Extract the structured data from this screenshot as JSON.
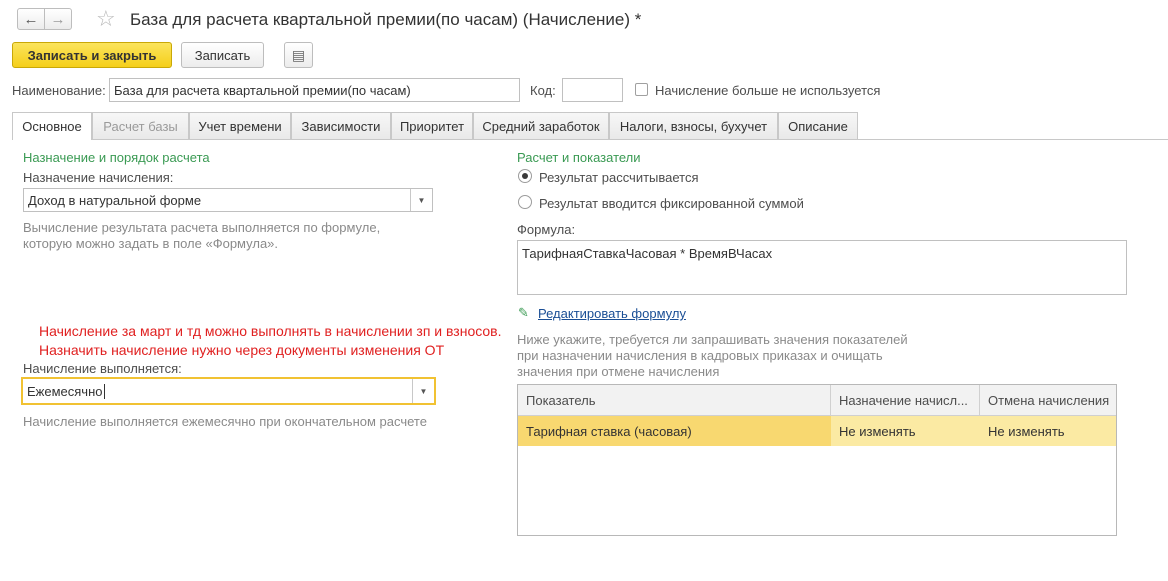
{
  "window": {
    "title": "База для расчета квартальной премии(по часам) (Начисление) *",
    "back_icon": "←",
    "forward_icon": "→",
    "favorite_icon": "☆"
  },
  "toolbar": {
    "save_close_label": "Записать и закрыть",
    "save_label": "Записать",
    "more_icon": "▤"
  },
  "header": {
    "name_label": "Наименование:",
    "name_value": "База для расчета квартальной премии(по часам)",
    "code_label": "Код:",
    "code_value": "",
    "not_used_label": "Начисление больше не используется"
  },
  "tabs": [
    {
      "label": "Основное"
    },
    {
      "label": "Расчет базы"
    },
    {
      "label": "Учет времени"
    },
    {
      "label": "Зависимости"
    },
    {
      "label": "Приоритет"
    },
    {
      "label": "Средний заработок"
    },
    {
      "label": "Налоги, взносы, бухучет"
    },
    {
      "label": "Описание"
    }
  ],
  "left": {
    "section_title": "Назначение и порядок расчета",
    "purpose_label": "Назначение начисления:",
    "purpose_value": "Доход в натуральной форме",
    "purpose_hint_1": "Вычисление результата расчета выполняется по формуле,",
    "purpose_hint_2": "которую можно задать в поле «Формула».",
    "note_line_1": "Начисление за март и тд можно выполнять в начислении зп и взносов.",
    "note_line_2": "Назначить начисление нужно через документы изменения ОТ",
    "performed_label": "Начисление выполняется:",
    "performed_value": "Ежемесячно",
    "performed_hint": "Начисление выполняется ежемесячно при окончательном расчете"
  },
  "right": {
    "section_title": "Расчет и показатели",
    "radio_calculated": "Результат рассчитывается",
    "radio_fixed": "Результат вводится фиксированной суммой",
    "formula_label": "Формула:",
    "formula_value": "ТарифнаяСтавкаЧасовая * ВремяВЧасах",
    "edit_formula_link": "Редактировать формулу",
    "indicators_hint_1": "Ниже укажите, требуется ли запрашивать значения показателей",
    "indicators_hint_2": "при назначении начисления в кадровых приказах и очищать",
    "indicators_hint_3": "значения при отмене начисления",
    "table": {
      "columns": [
        "Показатель",
        "Назначение начисл...",
        "Отмена начисления"
      ],
      "rows": [
        [
          "Тарифная ставка (часовая)",
          "Не изменять",
          "Не изменять"
        ]
      ]
    }
  }
}
